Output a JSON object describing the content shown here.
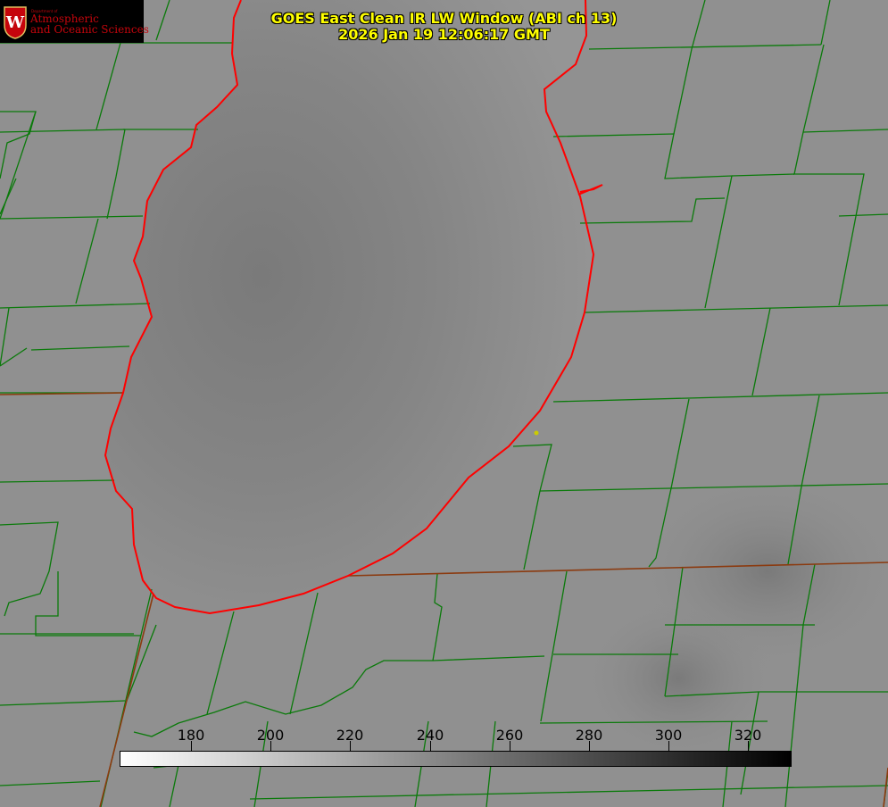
{
  "title": {
    "line1": "GOES East Clean IR LW Window (ABI ch 13)",
    "line2": "2026 Jan 19 12:06:17 GMT"
  },
  "logo": {
    "dept": "Department of",
    "line1": "Atmospheric",
    "line2": "and Oceanic Sciences"
  },
  "colorbar": {
    "ticks": [
      "180",
      "200",
      "220",
      "240",
      "260",
      "280",
      "300",
      "320"
    ],
    "min": 162,
    "max": 331,
    "colors": {
      "low": "#ffffff",
      "high": "#000000"
    }
  },
  "colors": {
    "lake_outline": "#ff0000",
    "county_lines": "#007a00",
    "state_lines": "#8b3a0f",
    "marker": "#cccc00"
  }
}
